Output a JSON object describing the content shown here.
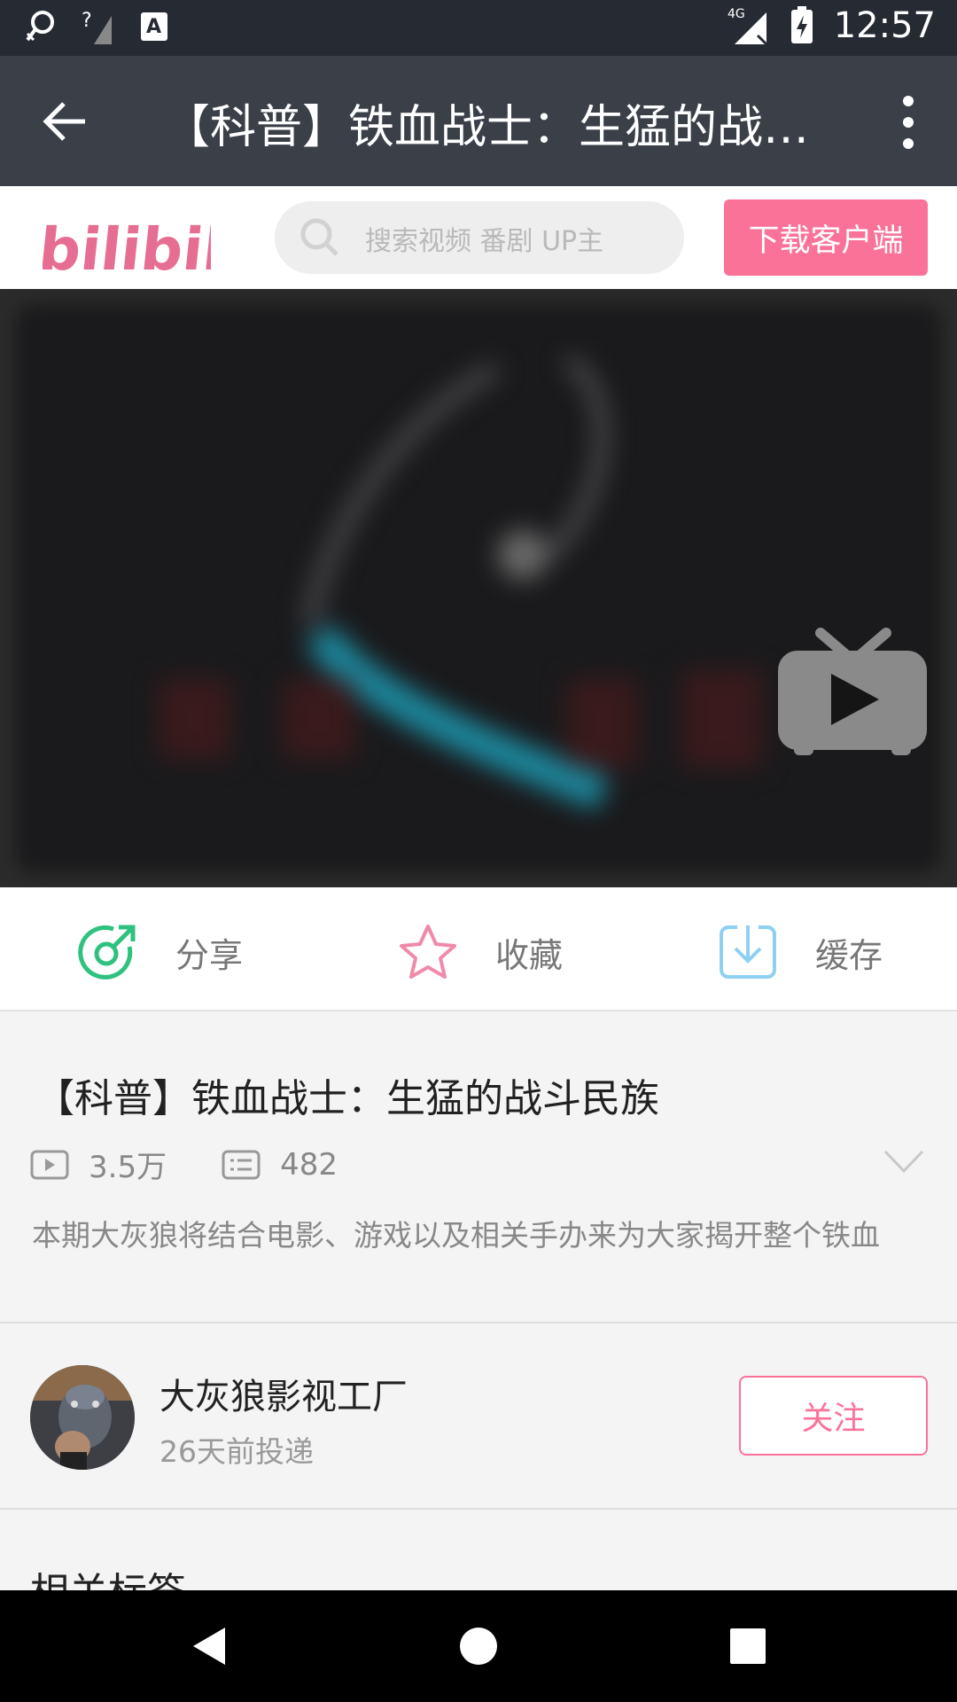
{
  "status_bar": {
    "time": "12:57",
    "network": "4G",
    "icons": [
      "location-icon",
      "signal-question-icon",
      "a-notification-icon",
      "network-4g-icon",
      "battery-charging-icon"
    ]
  },
  "app_bar": {
    "title": "【科普】铁血战士：生猛的战斗…"
  },
  "header": {
    "logo_text": "bilibili",
    "search_placeholder": "搜索视频 番剧 UP主",
    "download_label": "下载客户端"
  },
  "actions": {
    "share": "分享",
    "favorite": "收藏",
    "cache": "缓存"
  },
  "video_info": {
    "title": "【科普】铁血战士：生猛的战斗民族",
    "views": "3.5万",
    "danmaku": "482",
    "description": "本期大灰狼将结合电影、游戏以及相关手办来为大家揭开整个铁血"
  },
  "uploader": {
    "name": "大灰狼影视工厂",
    "posted": "26天前投递",
    "follow_label": "关注"
  },
  "tags_section": {
    "title": "相关标签"
  },
  "colors": {
    "brand_pink": "#fb7299",
    "share_green": "#2ec27e",
    "cache_blue": "#6ec6f0",
    "app_bar": "#3a3f48"
  }
}
